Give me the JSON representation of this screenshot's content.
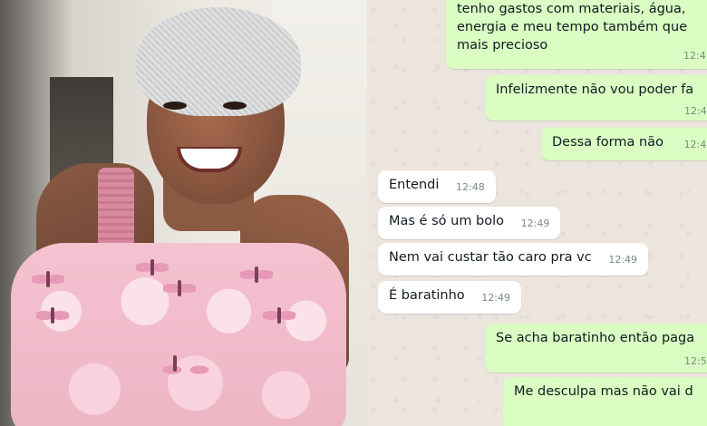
{
  "photo": {
    "alt_description_visible": false
  },
  "chat": {
    "messages": [
      {
        "id": "m1",
        "direction": "out",
        "lines": [
          "tenho gastos com materiais, água,",
          "energia e meu tempo também que",
          "mais precioso"
        ],
        "time": "12:4"
      },
      {
        "id": "m2",
        "direction": "out",
        "text": "Infelizmente não vou poder fa",
        "time": "12:4"
      },
      {
        "id": "m3",
        "direction": "out",
        "text": "Dessa forma não",
        "time": "12:4"
      },
      {
        "id": "m4",
        "direction": "in",
        "text": "Entendi",
        "time": "12:48"
      },
      {
        "id": "m5",
        "direction": "in",
        "text": "Mas é só um bolo",
        "time": "12:49"
      },
      {
        "id": "m6",
        "direction": "in",
        "text": "Nem vai custar tão caro pra vc",
        "time": "12:49"
      },
      {
        "id": "m7",
        "direction": "in",
        "text": "É baratinho",
        "time": "12:49"
      },
      {
        "id": "m8",
        "direction": "out",
        "text": "Se acha baratinho então paga",
        "time": "12:5"
      },
      {
        "id": "m9",
        "direction": "out",
        "text": "Me desculpa mas não vai d",
        "time": ""
      }
    ]
  },
  "colors": {
    "chat_background": "#ece5dd",
    "outgoing_bubble": "#d9fdc3",
    "incoming_bubble": "#ffffff",
    "timestamp": "#7a8a82"
  }
}
